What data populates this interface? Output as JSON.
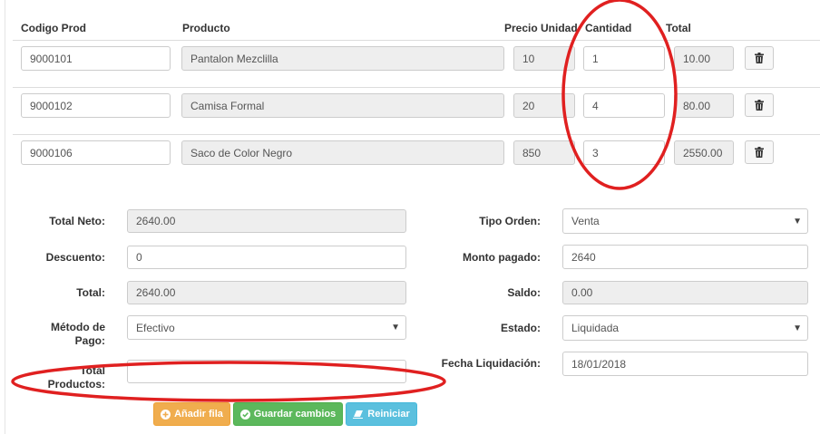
{
  "table": {
    "headers": {
      "codigo": "Codigo Prod",
      "producto": "Producto",
      "precio": "Precio Unidad",
      "cantidad": "Cantidad",
      "total": "Total"
    },
    "rows": [
      {
        "codigo": "9000101",
        "producto": "Pantalon Mezclilla",
        "precio": "10",
        "cantidad": "1",
        "total": "10.00"
      },
      {
        "codigo": "9000102",
        "producto": "Camisa Formal",
        "precio": "20",
        "cantidad": "4",
        "total": "80.00"
      },
      {
        "codigo": "9000106",
        "producto": "Saco de Color Negro",
        "precio": "850",
        "cantidad": "3",
        "total": "2550.00"
      }
    ]
  },
  "form": {
    "total_neto": {
      "label": "Total Neto:",
      "value": "2640.00"
    },
    "descuento": {
      "label": "Descuento:",
      "value": "0"
    },
    "total": {
      "label": "Total:",
      "value": "2640.00"
    },
    "metodo_pago": {
      "label_line1": "Método de",
      "label_line2": "Pago:",
      "value": "Efectivo"
    },
    "total_productos": {
      "label_line1": "Total",
      "label_line2": "Productos:",
      "value": ""
    },
    "tipo_orden": {
      "label": "Tipo Orden:",
      "value": "Venta"
    },
    "monto_pagado": {
      "label": "Monto pagado:",
      "value": "2640"
    },
    "saldo": {
      "label": "Saldo:",
      "value": "0.00"
    },
    "estado": {
      "label": "Estado:",
      "value": "Liquidada"
    },
    "fecha_liquidacion": {
      "label": "Fecha Liquidación:",
      "value": "18/01/2018"
    }
  },
  "buttons": {
    "add_row": "Añadir fila",
    "save": "Guardar cambios",
    "reset": "Reiniciar"
  },
  "colors": {
    "annotation": "#e02020",
    "btn_orange": "#f0ad4e",
    "btn_green": "#5cb85c",
    "btn_blue": "#5bc0de"
  }
}
